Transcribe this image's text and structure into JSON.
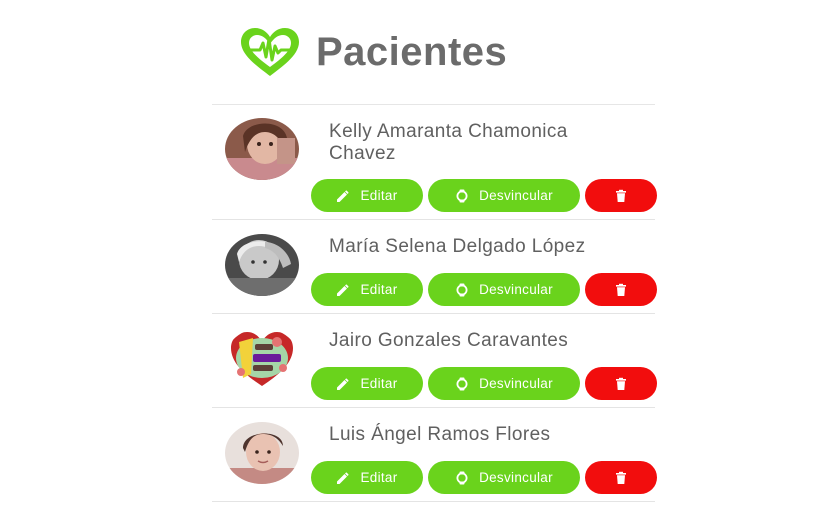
{
  "header": {
    "logo_icon": "heart-pulse-icon",
    "title": "Pacientes"
  },
  "colors": {
    "accent_green": "#6ad31c",
    "danger_red": "#f20d0d",
    "title_gray": "#6b6b6b",
    "name_gray": "#606060"
  },
  "patients": [
    {
      "name": "Kelly Amaranta Chamonica Chavez",
      "edit_label": "Editar",
      "unlink_label": "Desvincular",
      "delete_icon": "trash-icon"
    },
    {
      "name": "María Selena Delgado López",
      "edit_label": "Editar",
      "unlink_label": "Desvincular",
      "delete_icon": "trash-icon"
    },
    {
      "name": "Jairo Gonzales Caravantes",
      "edit_label": "Editar",
      "unlink_label": "Desvincular",
      "delete_icon": "trash-icon"
    },
    {
      "name": "Luis Ángel Ramos Flores",
      "edit_label": "Editar",
      "unlink_label": "Desvincular",
      "delete_icon": "trash-icon"
    }
  ]
}
